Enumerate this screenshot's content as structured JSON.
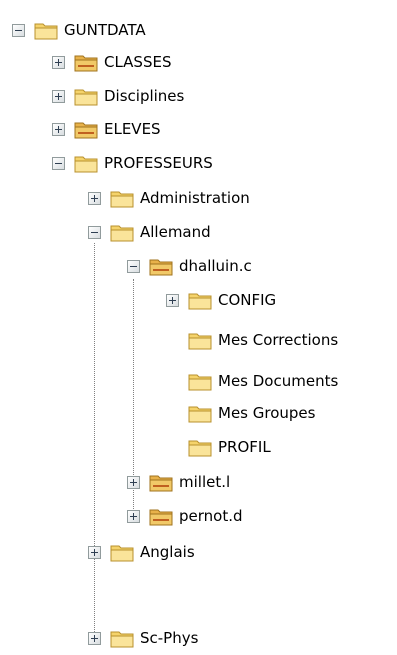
{
  "tree": {
    "root": "GUNTDATA",
    "classes": "CLASSES",
    "disciplines": "Disciplines",
    "eleves": "ELEVES",
    "professeurs": "PROFESSEURS",
    "administration": "Administration",
    "allemand": "Allemand",
    "dhalluin": "dhalluin.c",
    "config": "CONFIG",
    "mes_corrections": "Mes Corrections",
    "mes_documents": "Mes Documents",
    "mes_groupes": "Mes Groupes",
    "profil": "PROFIL",
    "millet": "millet.l",
    "pernot": "pernot.d",
    "anglais": "Anglais",
    "sc_phys": "Sc-Phys"
  },
  "colors": {
    "folder": "#f5d36b",
    "folder_shared": "#e8b24a",
    "line": "#808080"
  }
}
